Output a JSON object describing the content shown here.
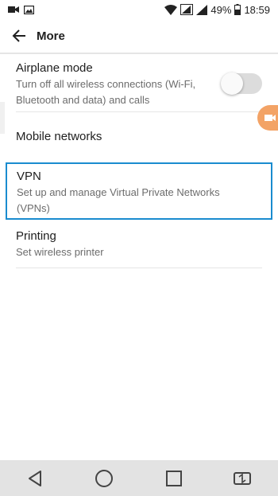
{
  "status_bar": {
    "battery_percent": "49%",
    "time": "18:59",
    "icons": [
      "camera-icon",
      "image-icon",
      "wifi-icon",
      "signal-icon",
      "signal-icon",
      "battery-icon"
    ]
  },
  "toolbar": {
    "title": "More",
    "back_icon": "arrow-left-icon"
  },
  "settings": [
    {
      "title": "Airplane mode",
      "subtitle": "Turn off all wireless connections (Wi-Fi, Bluetooth and data) and calls",
      "toggle": "off"
    },
    {
      "title": "Mobile networks"
    },
    {
      "title": "VPN",
      "subtitle": "Set up and manage Virtual Private Networks (VPNs)"
    },
    {
      "title": "Printing",
      "subtitle": "Set wireless printer"
    }
  ],
  "nav_bar": {
    "icons": [
      "back-triangle-icon",
      "home-circle-icon",
      "recents-square-icon",
      "switch-screen-icon"
    ]
  },
  "colors": {
    "highlight_border": "#1a8ccf",
    "bubble": "#f3a366",
    "nav_bar": "#e3e3e3"
  }
}
